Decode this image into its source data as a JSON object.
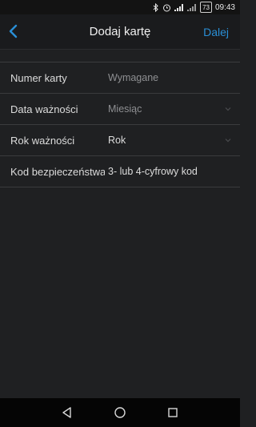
{
  "status_bar": {
    "time": "09:43",
    "battery": "73",
    "icons": [
      "bluetooth-icon",
      "alarm-icon",
      "signal-icon",
      "signal-icon",
      "battery-icon"
    ]
  },
  "header": {
    "title": "Dodaj kartę",
    "next_label": "Dalej",
    "back_icon": "chevron-left-icon",
    "accent_color": "#2a8fd6"
  },
  "form": {
    "rows": [
      {
        "label": "Numer karty",
        "value": "Wymagane",
        "dropdown": false
      },
      {
        "label": "Data ważności",
        "value": "Miesiąc",
        "dropdown": true
      },
      {
        "label": "Rok ważności",
        "value": "Rok",
        "dropdown": true
      },
      {
        "label": "Kod bezpieczeństwa",
        "value": "3- lub 4-cyfrowy kod",
        "dropdown": false
      }
    ]
  },
  "nav_bar": {
    "icons": [
      "back-triangle-icon",
      "home-circle-icon",
      "recents-square-icon"
    ]
  }
}
